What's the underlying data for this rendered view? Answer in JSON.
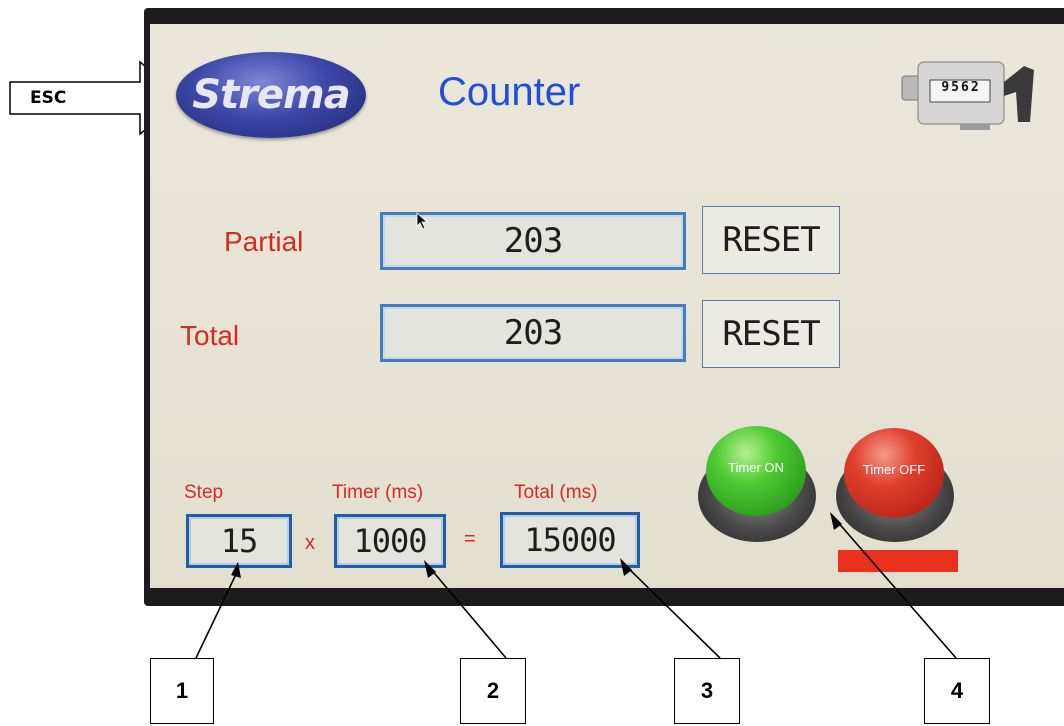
{
  "esc": {
    "label": "ESC"
  },
  "header": {
    "logo_text": "Strema",
    "title": "Counter",
    "counter_icon_digits": "9562"
  },
  "counters": {
    "partial": {
      "label": "Partial",
      "value": "203",
      "reset_label": "RESET"
    },
    "total": {
      "label": "Total",
      "value": "203",
      "reset_label": "RESET"
    }
  },
  "timer_config": {
    "step_label": "Step",
    "step_value": "15",
    "multiply": "x",
    "timer_label": "Timer (ms)",
    "timer_value": "1000",
    "equals": "=",
    "total_label": "Total (ms)",
    "total_value": "15000"
  },
  "timer_buttons": {
    "on_label": "Timer ON",
    "off_label": "Timer OFF"
  },
  "callouts": [
    "1",
    "2",
    "3",
    "4"
  ],
  "colors": {
    "title": "#1f4fd8",
    "label_red": "#d42a24",
    "field_border": "#3f7fc0",
    "timer_on": "#3cb82c",
    "timer_off": "#d62a20",
    "status_bar": "#e8321e"
  }
}
